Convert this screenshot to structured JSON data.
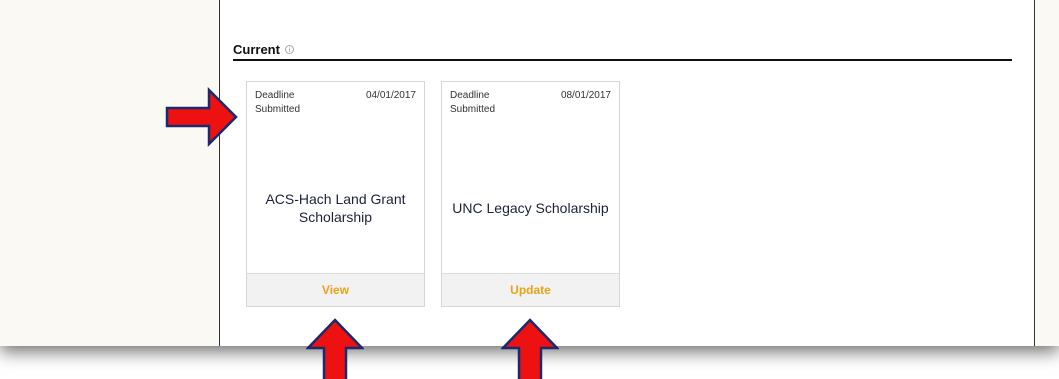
{
  "section": {
    "title": "Current",
    "info_icon": "info-icon"
  },
  "cards": [
    {
      "deadline_label": "Deadline",
      "deadline_date": "04/01/2017",
      "status": "Submitted",
      "title": "ACS-Hach Land Grant Scholarship",
      "action_label": "View"
    },
    {
      "deadline_label": "Deadline",
      "deadline_date": "08/01/2017",
      "status": "Submitted",
      "title": "UNC Legacy Scholarship",
      "action_label": "Update"
    }
  ],
  "colors": {
    "action_text": "#e8a317",
    "annotation_arrow": "#ee1111",
    "annotation_arrow_outline": "#1a2a6c"
  }
}
